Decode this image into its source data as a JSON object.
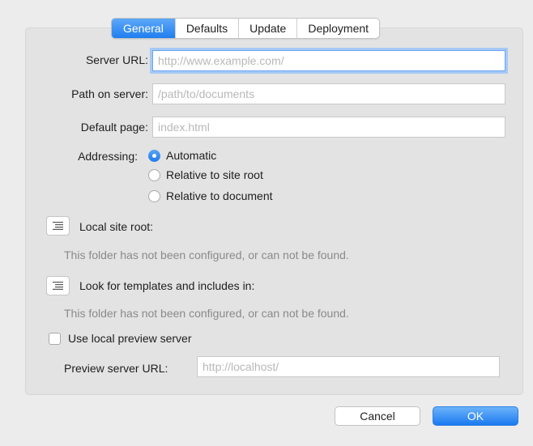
{
  "tabs": [
    {
      "label": "General",
      "active": true
    },
    {
      "label": "Defaults",
      "active": false
    },
    {
      "label": "Update",
      "active": false
    },
    {
      "label": "Deployment",
      "active": false
    }
  ],
  "form": {
    "server_url": {
      "label": "Server URL:",
      "placeholder": "http://www.example.com/",
      "value": ""
    },
    "path_on_server": {
      "label": "Path on server:",
      "placeholder": "/path/to/documents",
      "value": ""
    },
    "default_page": {
      "label": "Default page:",
      "placeholder": "index.html",
      "value": ""
    },
    "addressing": {
      "label": "Addressing:",
      "options": [
        {
          "label": "Automatic",
          "selected": true
        },
        {
          "label": "Relative to site root",
          "selected": false
        },
        {
          "label": "Relative to document",
          "selected": false
        }
      ]
    },
    "local_site_root": {
      "label": "Local site root:",
      "note": "This folder has not been configured, or can not be found.",
      "icon": "list-icon"
    },
    "templates": {
      "label": "Look for templates and includes in:",
      "note": "This folder has not been configured, or can not be found.",
      "icon": "list-icon"
    },
    "preview_server": {
      "checkbox_label": "Use local preview server",
      "checked": false
    },
    "preview_url": {
      "label": "Preview server URL:",
      "placeholder": "http://localhost/",
      "value": ""
    }
  },
  "buttons": {
    "cancel": "Cancel",
    "ok": "OK"
  },
  "colors": {
    "accent": "#1f7ef0",
    "panel": "#e3e3e3",
    "window": "#ececec"
  }
}
